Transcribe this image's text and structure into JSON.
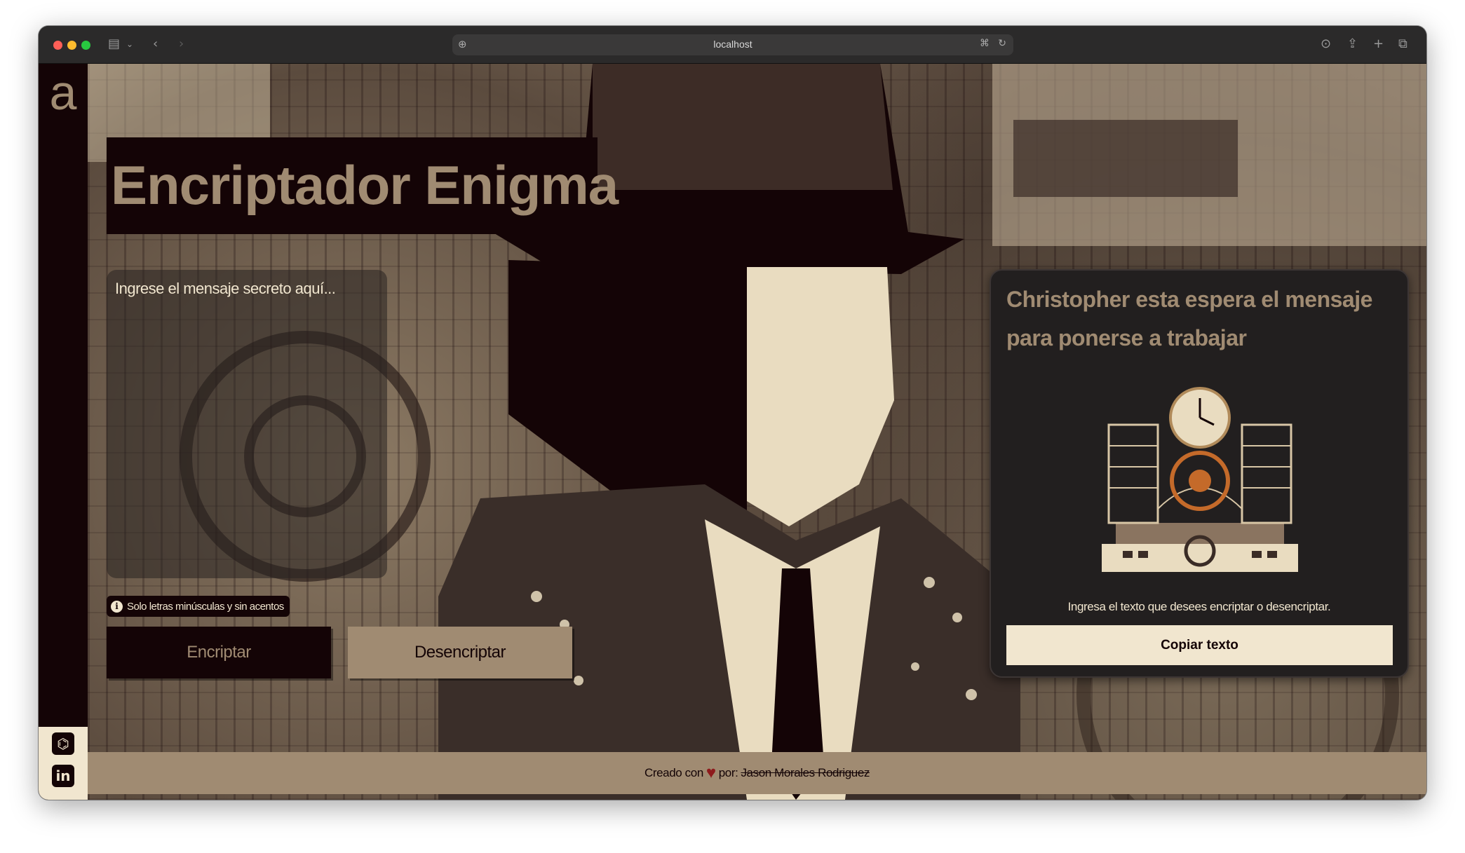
{
  "browser": {
    "url": "localhost"
  },
  "sidebar": {
    "logo": "a",
    "social": [
      {
        "icon": "github-icon",
        "glyph": "⌬"
      },
      {
        "icon": "linkedin-icon",
        "glyph": "in"
      }
    ]
  },
  "main": {
    "title": "Encriptador Enigma",
    "input_placeholder": "Ingrese el mensaje secreto aquí...",
    "hint": "Solo letras minúsculas y sin acentos",
    "encrypt_label": "Encriptar",
    "decrypt_label": "Desencriptar"
  },
  "panel": {
    "title": "Christopher esta espera el mensaje para ponerse a trabajar",
    "info": "Ingresa el texto que desees encriptar o desencriptar.",
    "copy_label": "Copiar texto"
  },
  "footer": {
    "created_with": "Creado con",
    "by": "por:",
    "author": "Jason Morales Rodriguez"
  },
  "colors": {
    "dark": "#140406",
    "tan": "#a08b72",
    "cream": "#f1e6cf",
    "heart": "#8e1a1c"
  }
}
